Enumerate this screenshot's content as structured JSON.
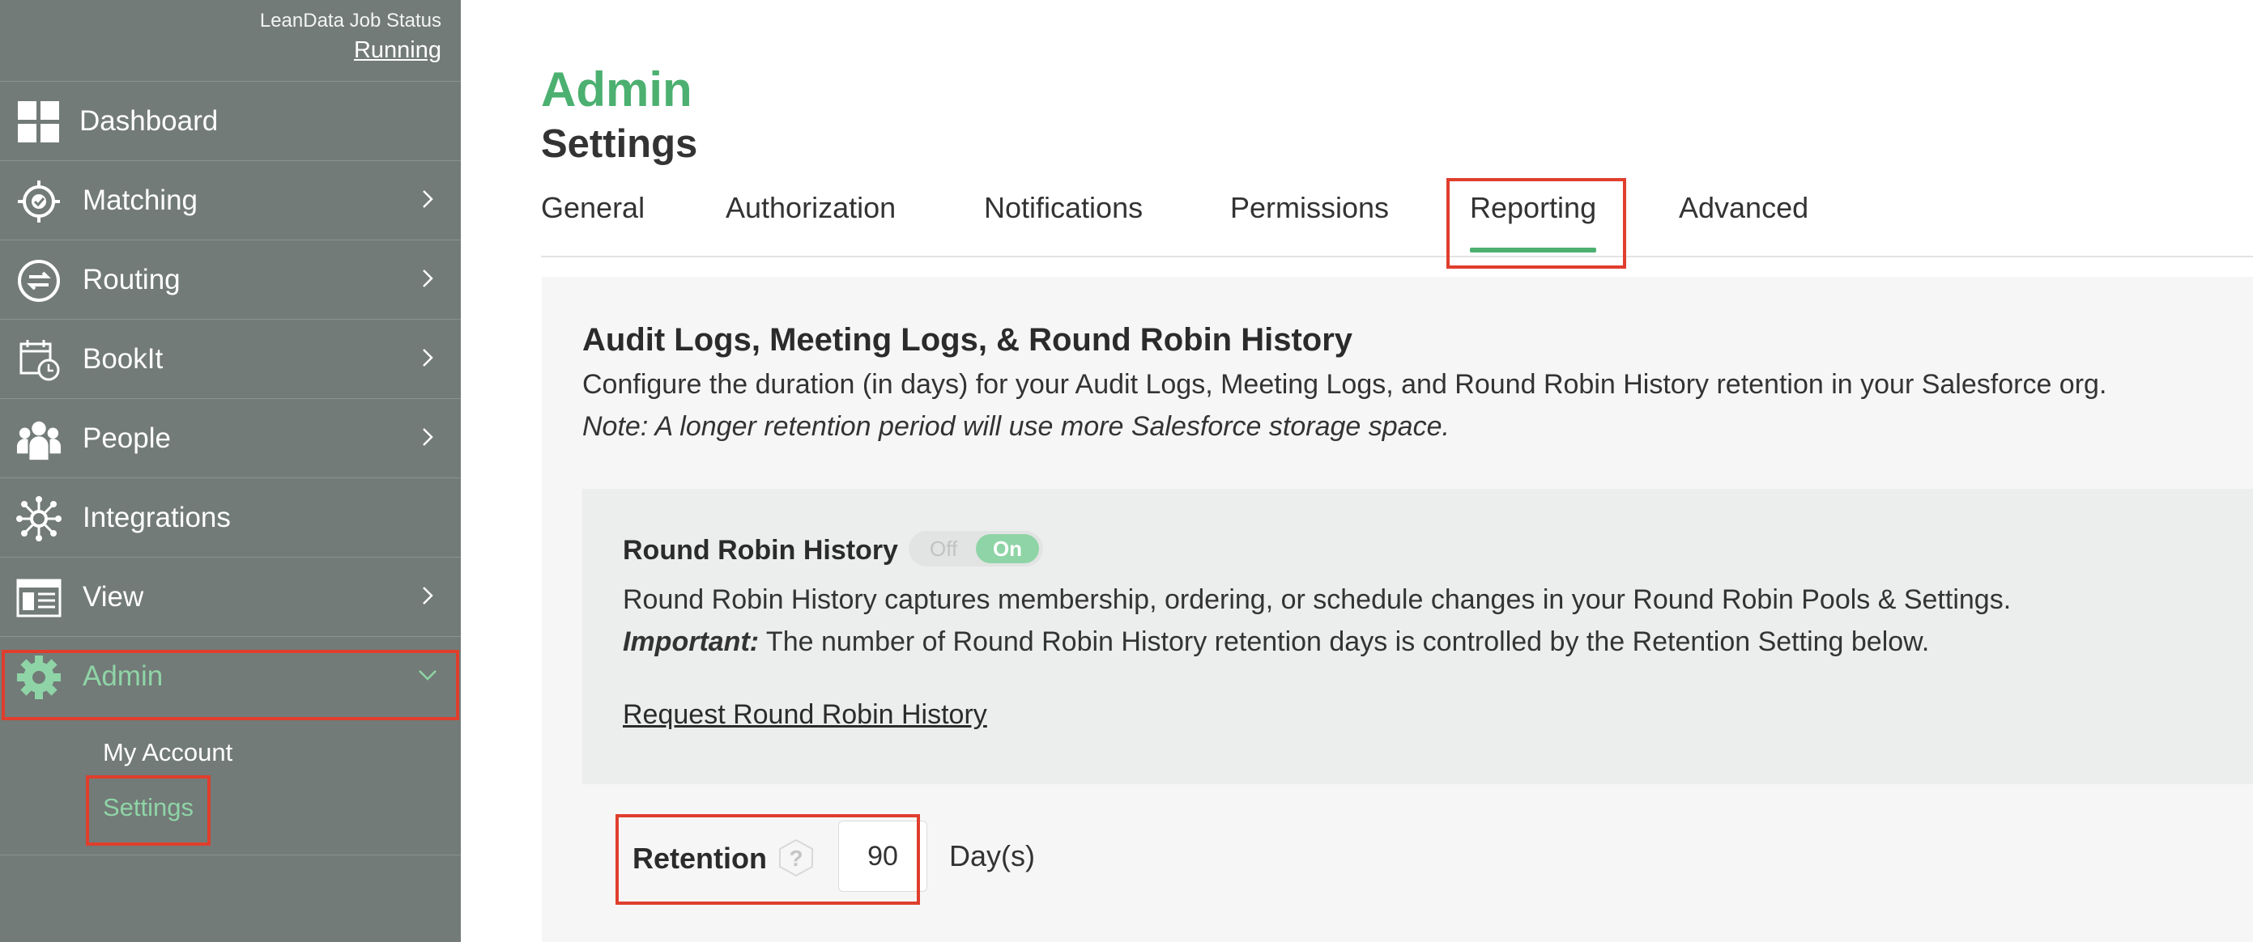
{
  "sidebar": {
    "job_status_label": "LeanData Job Status",
    "job_status_value": "Running",
    "items": [
      {
        "label": "Dashboard",
        "icon": "dashboard-grid-icon"
      },
      {
        "label": "Matching",
        "icon": "target-check-icon"
      },
      {
        "label": "Routing",
        "icon": "routing-arrows-icon"
      },
      {
        "label": "BookIt",
        "icon": "calendar-clock-icon"
      },
      {
        "label": "People",
        "icon": "people-group-icon"
      },
      {
        "label": "Integrations",
        "icon": "integrations-hub-icon"
      },
      {
        "label": "View",
        "icon": "view-window-icon"
      },
      {
        "label": "Admin",
        "icon": "gear-icon"
      }
    ],
    "admin_submenu": [
      "My Account",
      "Settings"
    ]
  },
  "header": {
    "title": "Admin",
    "subtitle": "Settings"
  },
  "tabs": [
    "General",
    "Authorization",
    "Notifications",
    "Permissions",
    "Reporting",
    "Advanced"
  ],
  "active_tab": "Reporting",
  "section": {
    "title": "Audit Logs, Meeting Logs, & Round Robin History",
    "description": "Configure the duration (in days) for your Audit Logs, Meeting Logs, and Round Robin History retention in your Salesforce org.",
    "note": "Note: A longer retention period will use more Salesforce storage space."
  },
  "round_robin": {
    "label": "Round Robin History",
    "toggle_off": "Off",
    "toggle_on": "On",
    "description": "Round Robin History captures membership, ordering, or schedule changes in your Round Robin Pools & Settings.",
    "important_label": "Important:",
    "important_text": " The number of Round Robin History retention days is controlled by the Retention Setting below.",
    "link": "Request Round Robin History"
  },
  "retention": {
    "label": "Retention",
    "help": "?",
    "value": "90",
    "unit": "Day(s)"
  },
  "colors": {
    "sidebar_bg": "#727b78",
    "accent_green": "#4cb070",
    "active_green": "#8fd4a6",
    "highlight_red": "#e03e2d"
  }
}
